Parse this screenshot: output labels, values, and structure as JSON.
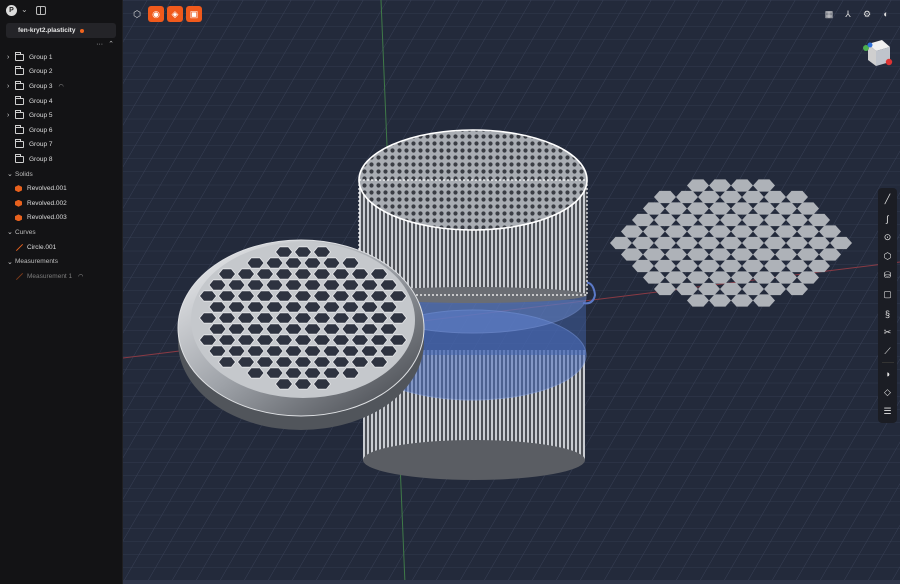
{
  "sidebar": {
    "avatar_letter": "P",
    "file_name": "fen-kryt2.plasticity",
    "groups": [
      {
        "label": "Group 1",
        "expandable": true
      },
      {
        "label": "Group 2",
        "expandable": false
      },
      {
        "label": "Group 3",
        "expandable": true,
        "hidden_toggle": true
      },
      {
        "label": "Group 4",
        "expandable": false
      },
      {
        "label": "Group 5",
        "expandable": true
      },
      {
        "label": "Group 6",
        "expandable": false
      },
      {
        "label": "Group 7",
        "expandable": false
      },
      {
        "label": "Group 8",
        "expandable": false
      }
    ],
    "solids_label": "Solids",
    "solids": [
      "Revolved.001",
      "Revolved.002",
      "Revolved.003"
    ],
    "curves_label": "Curves",
    "curves": [
      "Circle.001"
    ],
    "measurements_label": "Measurements",
    "measurements": [
      "Measurement 1"
    ]
  },
  "colors": {
    "accent": "#f05a1c",
    "viewport_bg": "#232a3b",
    "sidebar_bg": "#131315"
  },
  "icons": {
    "top_left": [
      "select-mode-icon",
      "vertex-mode-icon",
      "edge-mode-icon",
      "face-mode-icon"
    ],
    "top_right": [
      "grid-icon",
      "axes-icon",
      "snap-icon",
      "render-mode-icon"
    ],
    "right_tools": [
      "line-icon",
      "curve-icon",
      "circle-icon",
      "polygon-icon",
      "cylinder-icon",
      "rectangle-icon",
      "spiral-icon",
      "trim-icon",
      "fillet-curve-icon",
      "boolean-icon",
      "box-icon",
      "stack-icon"
    ]
  }
}
